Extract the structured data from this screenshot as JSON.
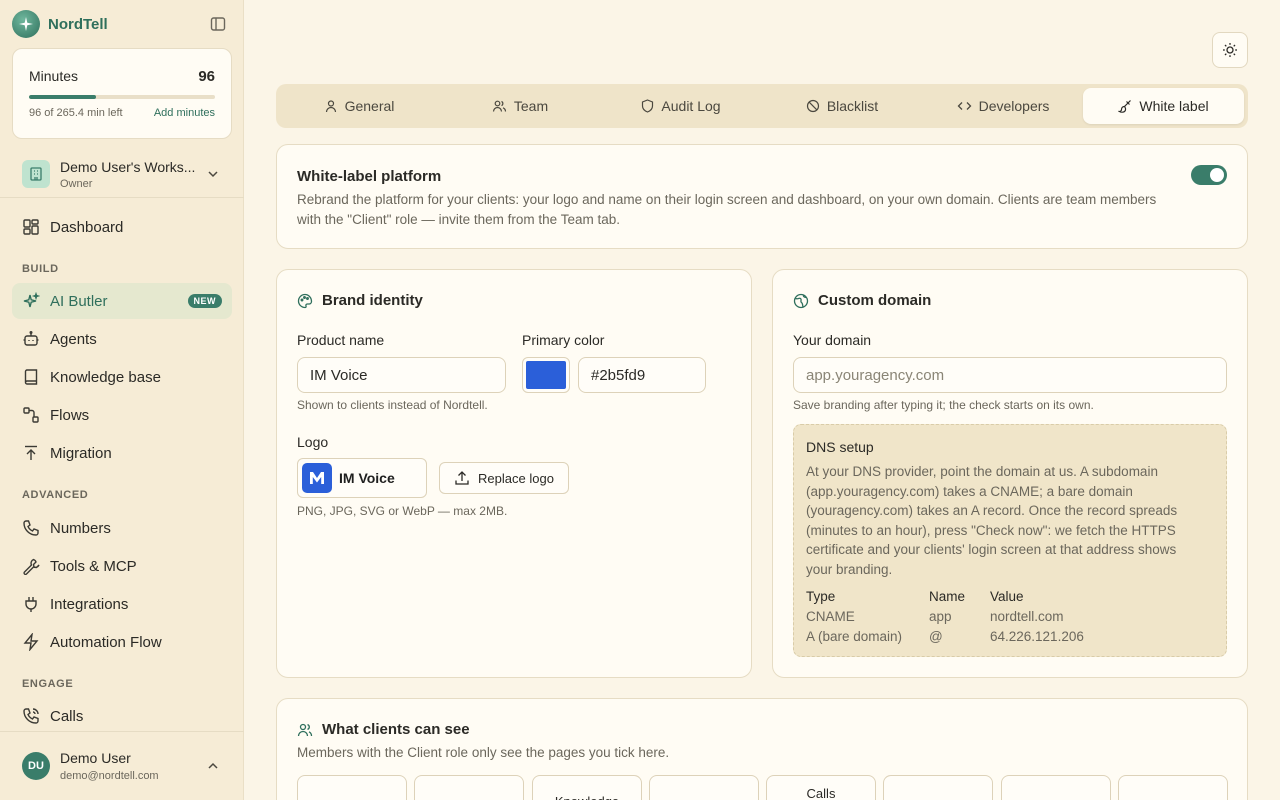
{
  "brand": {
    "name": "NordTell"
  },
  "minutes": {
    "title": "Minutes",
    "value": "96",
    "progress": 0.3625,
    "left_text": "96 of 265.4 min left",
    "add_label": "Add minutes"
  },
  "workspace": {
    "name": "Demo User's Works...",
    "role": "Owner"
  },
  "nav": {
    "dashboard": "Dashboard",
    "sections": {
      "build": "BUILD",
      "advanced": "ADVANCED",
      "engage": "ENGAGE"
    },
    "ai_butler": "AI Butler",
    "new_badge": "NEW",
    "agents": "Agents",
    "knowledge_base": "Knowledge base",
    "flows": "Flows",
    "migration": "Migration",
    "numbers": "Numbers",
    "tools_mcp": "Tools & MCP",
    "integrations": "Integrations",
    "automation_flow": "Automation Flow",
    "calls": "Calls"
  },
  "user": {
    "initials": "DU",
    "name": "Demo User",
    "email": "demo@nordtell.com"
  },
  "tabs": {
    "general": "General",
    "team": "Team",
    "audit_log": "Audit Log",
    "blacklist": "Blacklist",
    "developers": "Developers",
    "white_label": "White label"
  },
  "whitelabel": {
    "title": "White-label platform",
    "enabled": true,
    "description": "Rebrand the platform for your clients: your logo and name on their login screen and dashboard, on your own domain. Clients are team members with the \"Client\" role — invite them from the Team tab."
  },
  "brand_identity": {
    "title": "Brand identity",
    "product_name_label": "Product name",
    "product_name_value": "IM Voice",
    "product_name_hint": "Shown to clients instead of Nordtell.",
    "primary_color_label": "Primary color",
    "primary_color_value": "#2b5fd9",
    "logo_label": "Logo",
    "logo_text": "IM Voice",
    "replace_logo_label": "Replace logo",
    "logo_hint": "PNG, JPG, SVG or WebP — max 2MB."
  },
  "custom_domain": {
    "title": "Custom domain",
    "domain_label": "Your domain",
    "domain_placeholder": "app.youragency.com",
    "domain_hint": "Save branding after typing it; the check starts on its own.",
    "dns_title": "DNS setup",
    "dns_description": "At your DNS provider, point the domain at us. A subdomain (app.youragency.com) takes a CNAME; a bare domain (youragency.com) takes an A record. Once the record spreads (minutes to an hour), press \"Check now\": we fetch the HTTPS certificate and your clients' login screen at that address shows your branding.",
    "table_headers": [
      "Type",
      "Name",
      "Value"
    ],
    "table_rows": [
      [
        "CNAME",
        "app",
        "nordtell.com"
      ],
      [
        "A (bare domain)",
        "@",
        "64.226.121.206"
      ]
    ]
  },
  "client_visibility": {
    "title": "What clients can see",
    "description": "Members with the Client role only see the pages you tick here.",
    "tiles": [
      "",
      "",
      "Knowledge",
      "",
      "Calls",
      "",
      "",
      ""
    ]
  },
  "colors": {
    "accent": "#3a7d6a",
    "brand_primary": "#2b5fd9",
    "background": "#fbf5e7",
    "sidebar": "#f6ecd6"
  }
}
